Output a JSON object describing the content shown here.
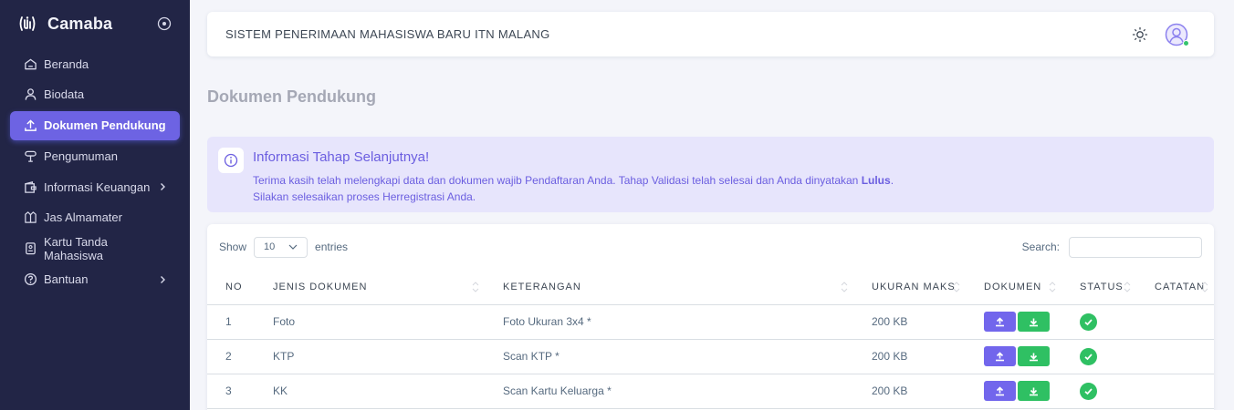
{
  "sidebar": {
    "brand": "Camaba",
    "items": [
      {
        "label": "Beranda",
        "icon": "home-icon"
      },
      {
        "label": "Biodata",
        "icon": "user-icon"
      },
      {
        "label": "Dokumen Pendukung",
        "icon": "upload-icon",
        "active": true
      },
      {
        "label": "Pengumuman",
        "icon": "megaphone-icon"
      },
      {
        "label": "Informasi Keuangan",
        "icon": "wallet-icon",
        "has_submenu": true
      },
      {
        "label": "Jas Almamater",
        "icon": "jacket-icon"
      },
      {
        "label": "Kartu Tanda Mahasiswa",
        "icon": "id-card-icon"
      },
      {
        "label": "Bantuan",
        "icon": "help-icon",
        "has_submenu": true
      }
    ]
  },
  "navbar": {
    "title": "SISTEM PENERIMAAN MAHASISWA BARU ITN MALANG"
  },
  "page": {
    "title": "Dokumen Pendukung"
  },
  "alert": {
    "title": "Informasi Tahap Selanjutnya!",
    "line1_prefix": "Terima kasih telah melengkapi data dan dokumen wajib Pendaftaran Anda. Tahap Validasi telah selesai dan Anda dinyatakan ",
    "line1_bold": "Lulus",
    "line1_suffix": ".",
    "line2": "Silakan selesaikan proses Herregistrasi Anda."
  },
  "table_controls": {
    "show_label": "Show",
    "show_value": "10",
    "entries_label": "entries",
    "search_label": "Search:"
  },
  "table": {
    "headers": [
      "NO",
      "JENIS DOKUMEN",
      "KETERANGAN",
      "UKURAN MAKS",
      "DOKUMEN",
      "STATUS",
      "CATATAN"
    ],
    "rows": [
      {
        "no": "1",
        "jenis": "Foto",
        "keterangan": "Foto Ukuran 3x4 *",
        "ukuran": "200 KB",
        "status": "valid"
      },
      {
        "no": "2",
        "jenis": "KTP",
        "keterangan": "Scan KTP *",
        "ukuran": "200 KB",
        "status": "valid"
      },
      {
        "no": "3",
        "jenis": "KK",
        "keterangan": "Scan Kartu Keluarga *",
        "ukuran": "200 KB",
        "status": "valid"
      }
    ]
  },
  "colors": {
    "sidebar_bg": "#222546",
    "accent": "#6d63e3",
    "success": "#2fc063",
    "alert_bg": "#e7e5fc"
  }
}
